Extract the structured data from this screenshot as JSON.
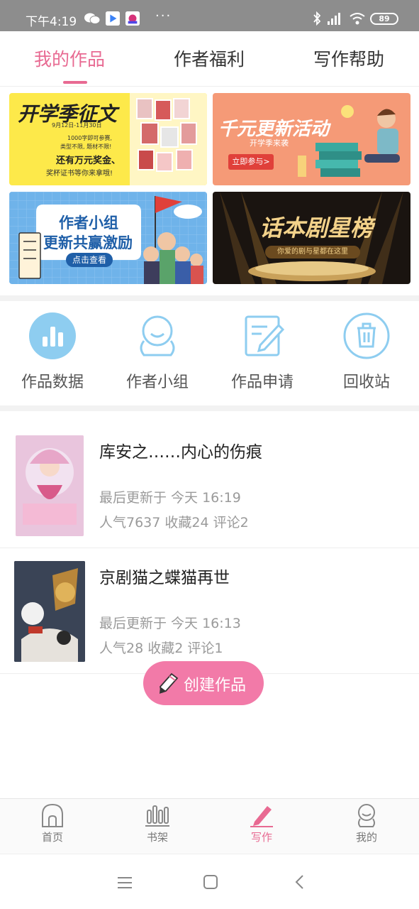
{
  "status_bar": {
    "time": "下午4:19",
    "dots": "···",
    "battery": "89"
  },
  "top_tabs": [
    {
      "label": "我的作品",
      "active": true
    },
    {
      "label": "作者福利",
      "active": false
    },
    {
      "label": "写作帮助",
      "active": false
    }
  ],
  "banners": [
    {
      "title": "开学季征文",
      "lines": [
        "9月12日-11月30日",
        "1000字即可参赛,",
        "类型不限, 题材不限!",
        "还有万元奖金、",
        "奖杯证书等你来拿哦!"
      ]
    },
    {
      "title": "千元更新活动",
      "subtitle": "开学季来袭",
      "button": "立即参与>"
    },
    {
      "title_line1": "作者小组",
      "title_line2": "更新共赢激励",
      "button": "点击查看"
    },
    {
      "title": "话本剧星榜",
      "subtitle": "你爱的剧与星都在这里"
    }
  ],
  "quick_entries": [
    {
      "label": "作品数据",
      "icon": "bar-chart-icon"
    },
    {
      "label": "作者小组",
      "icon": "group-icon"
    },
    {
      "label": "作品申请",
      "icon": "edit-doc-icon"
    },
    {
      "label": "回收站",
      "icon": "trash-icon"
    }
  ],
  "works": [
    {
      "title": "库安之……内心的伤痕",
      "updated": "最后更新于 今天 16:19",
      "stats": "人气7637  收藏24  评论2"
    },
    {
      "title": "京剧猫之蝶猫再世",
      "updated": "最后更新于 今天 16:13",
      "stats": "人气28  收藏2  评论1"
    }
  ],
  "fab": {
    "label": "创建作品"
  },
  "bottom_nav": [
    {
      "label": "首页",
      "icon": "home-icon",
      "active": false
    },
    {
      "label": "书架",
      "icon": "bookshelf-icon",
      "active": false
    },
    {
      "label": "写作",
      "icon": "pen-icon",
      "active": true
    },
    {
      "label": "我的",
      "icon": "profile-icon",
      "active": false
    }
  ],
  "colors": {
    "accent": "#e86a92",
    "icon_blue": "#8ecdf0",
    "fab": "#f27aa8"
  }
}
